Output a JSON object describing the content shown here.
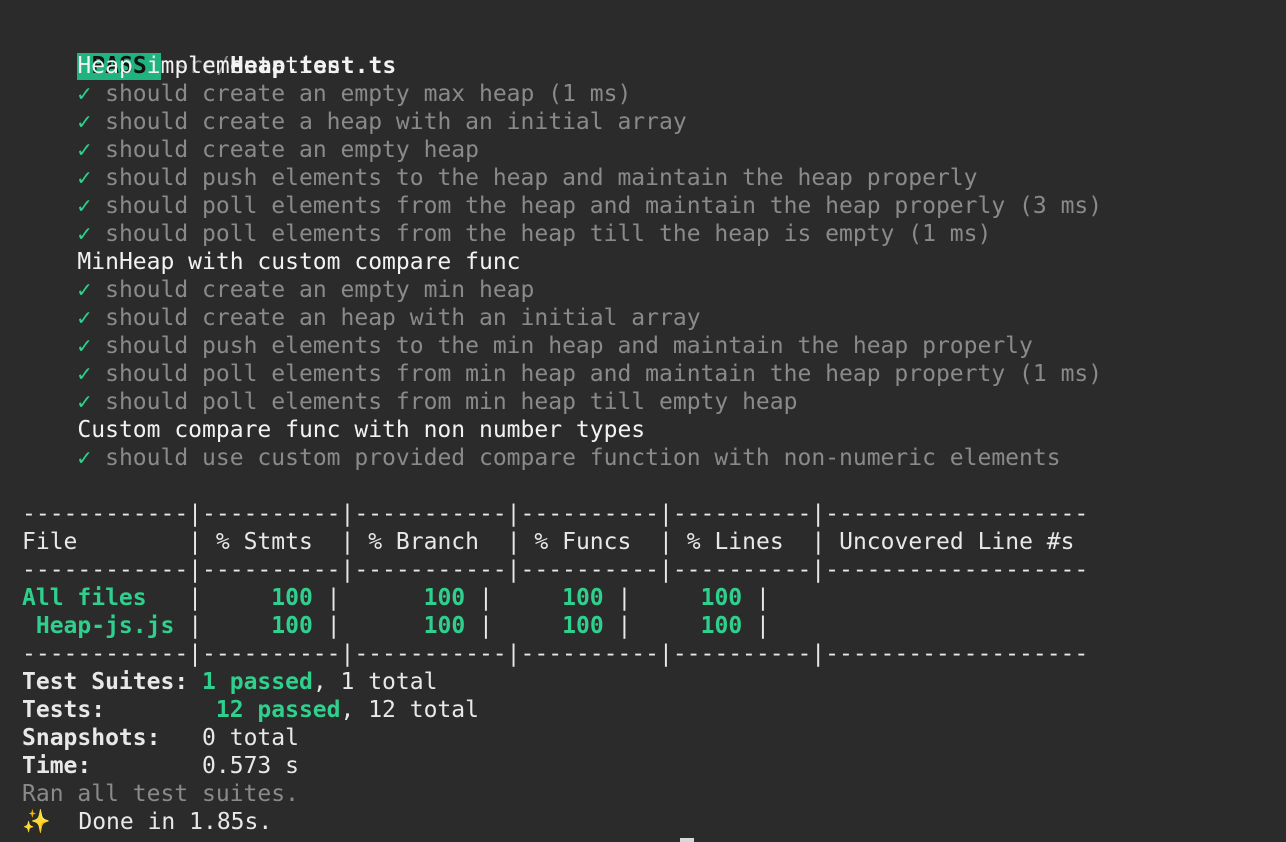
{
  "header": {
    "pass_badge": "PASS",
    "file_dir": "src/",
    "file_name": "Heap.test.ts"
  },
  "suites": [
    {
      "title": "Heap implementation",
      "tests": [
        {
          "check": "✓",
          "name": "should create an empty max heap",
          "time": " (1 ms)"
        },
        {
          "check": "✓",
          "name": "should create a heap with an initial array",
          "time": ""
        },
        {
          "check": "✓",
          "name": "should create an empty heap",
          "time": ""
        },
        {
          "check": "✓",
          "name": "should push elements to the heap and maintain the heap properly",
          "time": ""
        },
        {
          "check": "✓",
          "name": "should poll elements from the heap and maintain the heap properly",
          "time": " (3 ms)"
        },
        {
          "check": "✓",
          "name": "should poll elements from the heap till the heap is empty",
          "time": " (1 ms)"
        }
      ]
    },
    {
      "title": "MinHeap with custom compare func",
      "tests": [
        {
          "check": "✓",
          "name": "should create an empty min heap",
          "time": ""
        },
        {
          "check": "✓",
          "name": "should create an heap with an initial array",
          "time": ""
        },
        {
          "check": "✓",
          "name": "should push elements to the min heap and maintain the heap properly",
          "time": ""
        },
        {
          "check": "✓",
          "name": "should poll elements from min heap and maintain the heap property",
          "time": " (1 ms)"
        },
        {
          "check": "✓",
          "name": "should poll elements from min heap till empty heap",
          "time": ""
        }
      ]
    },
    {
      "title": "Custom compare func with non number types",
      "tests": [
        {
          "check": "✓",
          "name": "should use custom provided compare function with non-numeric elements",
          "time": ""
        }
      ]
    }
  ],
  "coverage": {
    "separator": "------------|----------|-----------|----------|----------|-------------------",
    "headers": [
      "File",
      "% Stmts",
      "% Branch",
      "% Funcs",
      "% Lines",
      "Uncovered Line #s"
    ],
    "rows": [
      {
        "file": "All files",
        "stmts": "100",
        "branch": "100",
        "funcs": "100",
        "lines": "100",
        "uncovered": ""
      },
      {
        "file": " Heap-js.js",
        "stmts": "100",
        "branch": "100",
        "funcs": "100",
        "lines": "100",
        "uncovered": ""
      }
    ]
  },
  "summary": {
    "suites_label": "Test Suites:",
    "suites_passed": "1 passed",
    "suites_total": ", 1 total",
    "tests_label": "Tests:",
    "tests_passed": "12 passed",
    "tests_total": ", 12 total",
    "snapshots_label": "Snapshots:",
    "snapshots_value": "0 total",
    "time_label": "Time:",
    "time_value": "0.573 s",
    "ran_all": "Ran all test suites.",
    "done_icon": "✨",
    "done_text": "Done in 1.85s."
  },
  "colors": {
    "background": "#2b2b2b",
    "pass_badge": "#1fb37f",
    "success_green": "#2fd08d"
  }
}
